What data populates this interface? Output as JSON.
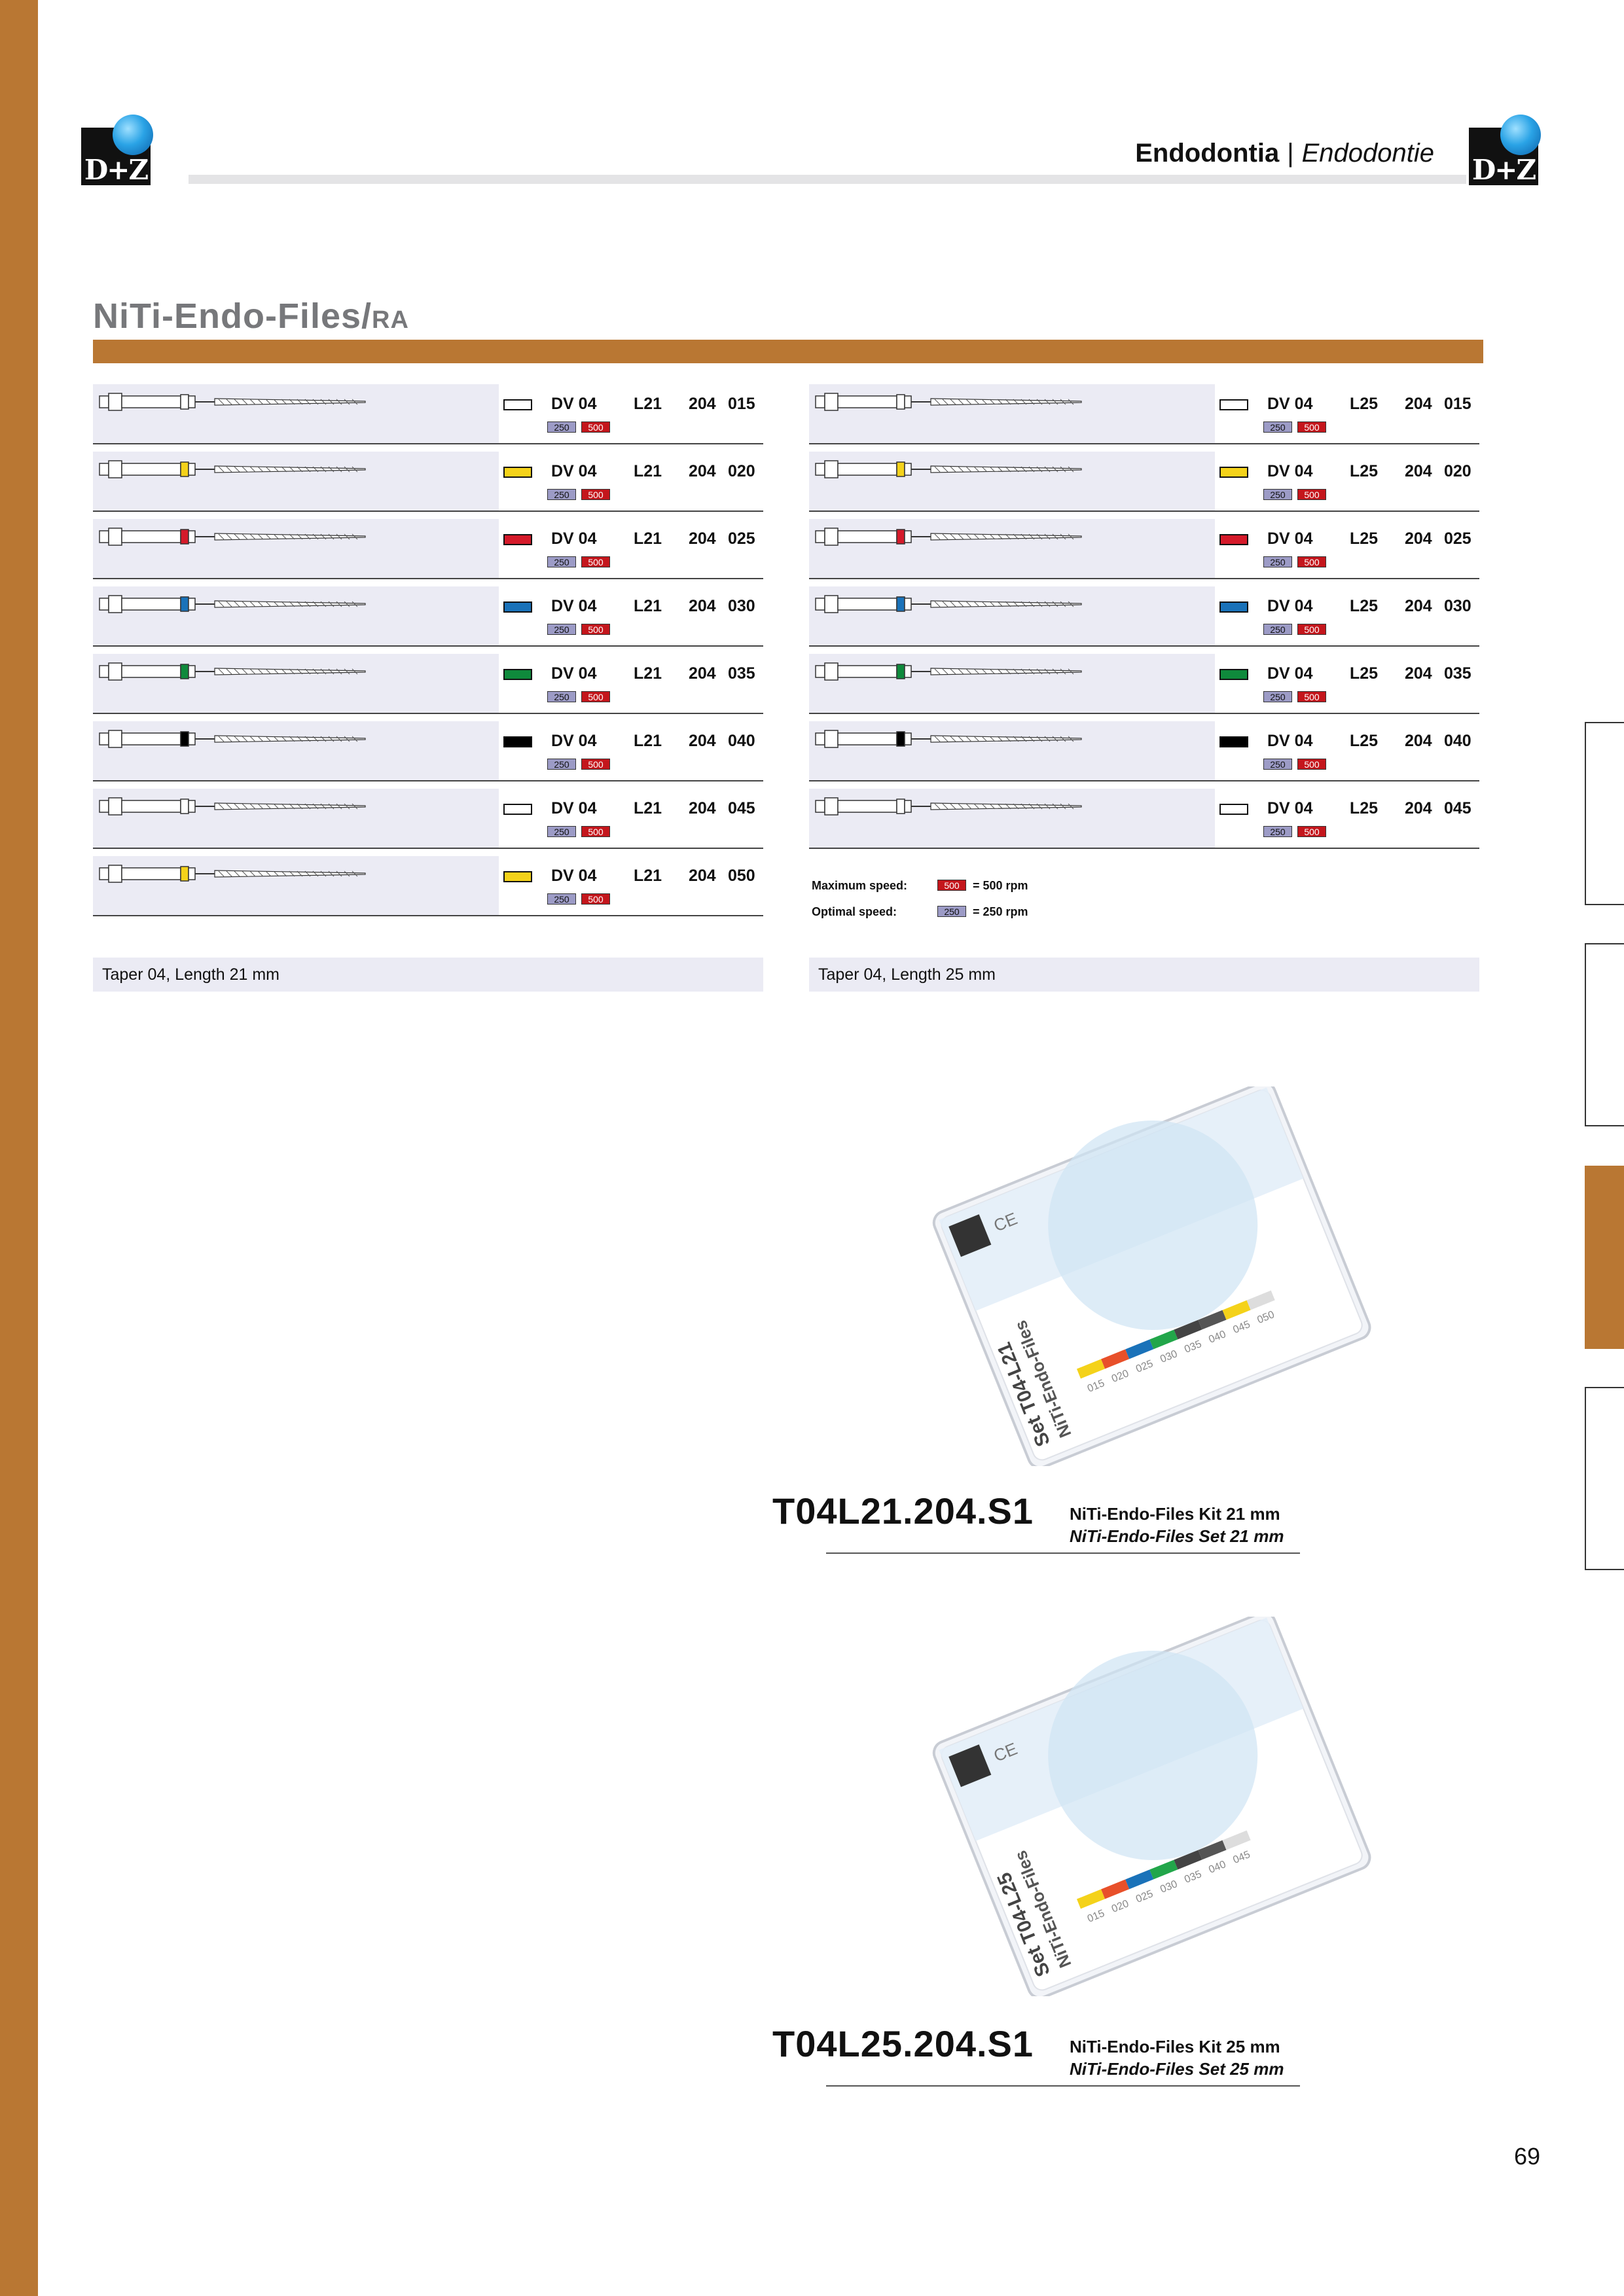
{
  "header": {
    "title_it": "Endodontia",
    "separator": "|",
    "title_de": "Endodontie",
    "logo_text": "D+Z"
  },
  "section": {
    "title_main": "NiTi-Endo-Files/",
    "title_suffix": "RA"
  },
  "colors": {
    "accent": "#b97733",
    "speed_max": "#c4161c",
    "speed_opt": "#9c9bc6"
  },
  "left_table": {
    "rows": [
      {
        "color": "#ffffff",
        "model": "DV 04",
        "length": "L21",
        "series": "204",
        "size": "015",
        "opt": "250",
        "max": "500"
      },
      {
        "color": "#f4d21a",
        "model": "DV 04",
        "length": "L21",
        "series": "204",
        "size": "020",
        "opt": "250",
        "max": "500"
      },
      {
        "color": "#d51a2a",
        "model": "DV 04",
        "length": "L21",
        "series": "204",
        "size": "025",
        "opt": "250",
        "max": "500"
      },
      {
        "color": "#1a72b9",
        "model": "DV 04",
        "length": "L21",
        "series": "204",
        "size": "030",
        "opt": "250",
        "max": "500"
      },
      {
        "color": "#0f8a3c",
        "model": "DV 04",
        "length": "L21",
        "series": "204",
        "size": "035",
        "opt": "250",
        "max": "500"
      },
      {
        "color": "#000000",
        "model": "DV 04",
        "length": "L21",
        "series": "204",
        "size": "040",
        "opt": "250",
        "max": "500"
      },
      {
        "color": "#ffffff",
        "model": "DV 04",
        "length": "L21",
        "series": "204",
        "size": "045",
        "opt": "250",
        "max": "500"
      },
      {
        "color": "#f4d21a",
        "model": "DV 04",
        "length": "L21",
        "series": "204",
        "size": "050",
        "opt": "250",
        "max": "500"
      }
    ],
    "caption": "Taper 04, Length 21 mm"
  },
  "right_table": {
    "rows": [
      {
        "color": "#ffffff",
        "model": "DV 04",
        "length": "L25",
        "series": "204",
        "size": "015",
        "opt": "250",
        "max": "500"
      },
      {
        "color": "#f4d21a",
        "model": "DV 04",
        "length": "L25",
        "series": "204",
        "size": "020",
        "opt": "250",
        "max": "500"
      },
      {
        "color": "#d51a2a",
        "model": "DV 04",
        "length": "L25",
        "series": "204",
        "size": "025",
        "opt": "250",
        "max": "500"
      },
      {
        "color": "#1a72b9",
        "model": "DV 04",
        "length": "L25",
        "series": "204",
        "size": "030",
        "opt": "250",
        "max": "500"
      },
      {
        "color": "#0f8a3c",
        "model": "DV 04",
        "length": "L25",
        "series": "204",
        "size": "035",
        "opt": "250",
        "max": "500"
      },
      {
        "color": "#000000",
        "model": "DV 04",
        "length": "L25",
        "series": "204",
        "size": "040",
        "opt": "250",
        "max": "500"
      },
      {
        "color": "#ffffff",
        "model": "DV 04",
        "length": "L25",
        "series": "204",
        "size": "045",
        "opt": "250",
        "max": "500"
      }
    ],
    "caption": "Taper 04, Length 25 mm"
  },
  "legend": {
    "max_label": "Maximum speed:",
    "max_badge": "500",
    "max_text": "= 500 rpm",
    "opt_label": "Optimal speed:",
    "opt_badge": "250",
    "opt_text": "= 250 rpm"
  },
  "kits": [
    {
      "code": "T04L21.204.S1",
      "name_it": "NiTi-Endo-Files Kit 21 mm",
      "name_de": "NiTi-Endo-Files Set 21 mm",
      "box_label_1": "Set T04-L21",
      "box_label_2": "NiTi-Endo-Files",
      "box_ce": "CE",
      "box_sizes": [
        "015",
        "020",
        "025",
        "030",
        "035",
        "040",
        "045",
        "050"
      ],
      "box_colors": [
        "#f4d21a",
        "#e8502a",
        "#1a72b9",
        "#22a64a",
        "#444444",
        "#555555",
        "#f4d21a",
        "#dddddd"
      ]
    },
    {
      "code": "T04L25.204.S1",
      "name_it": "NiTi-Endo-Files Kit 25 mm",
      "name_de": "NiTi-Endo-Files Set 25 mm",
      "box_label_1": "Set T04-L25",
      "box_label_2": "NiTi-Endo-Files",
      "box_ce": "CE",
      "box_sizes": [
        "015",
        "020",
        "025",
        "030",
        "035",
        "040",
        "045"
      ],
      "box_colors": [
        "#f4d21a",
        "#e8502a",
        "#1a72b9",
        "#22a64a",
        "#444444",
        "#555555",
        "#dddddd"
      ]
    }
  ],
  "page_number": "69"
}
